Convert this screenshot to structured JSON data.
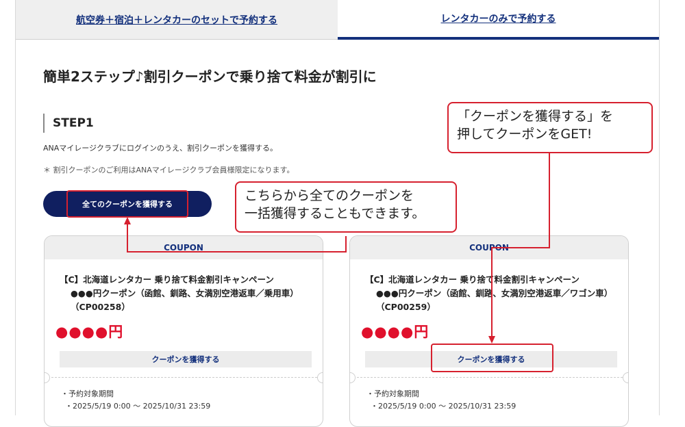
{
  "tabs": {
    "set_booking": "航空券＋宿泊＋レンタカーのセットで予約する",
    "rental_only": "レンタカーのみで予約する"
  },
  "main": {
    "heading": "簡単2ステップ♪割引クーポンで乗り捨て料金が割引に",
    "step_title": "STEP1",
    "step_desc": "ANAマイレージクラブにログインのうえ、割引クーポンを獲得する。",
    "step_note": "＊ 割引クーポンのご利用はANAマイレージクラブ会員様限定になります。",
    "get_all_button": "全てのクーポンを獲得する"
  },
  "coupons": [
    {
      "header": "COUPON",
      "title_line1": "【C】北海道レンタカー 乗り捨て料金割引キャンペーン",
      "title_line2": "●●●円クーポン（函館、釧路、女満別空港返車／乗用車）（CP00258）",
      "price": "●●●●円",
      "button": "クーポンを獲得する",
      "period_label": "・予約対象期間",
      "period": "・2025/5/19 0:00 ～ 2025/10/31 23:59"
    },
    {
      "header": "COUPON",
      "title_line1": "【C】北海道レンタカー 乗り捨て料金割引キャンペーン",
      "title_line2": "●●●円クーポン（函館、釧路、女満別空港返車／ワゴン車）（CP00259）",
      "price": "●●●●円",
      "button": "クーポンを獲得する",
      "period_label": "・予約対象期間",
      "period": "・2025/5/19 0:00 ～ 2025/10/31 23:59"
    }
  ],
  "annotations": {
    "callout_right_line1": "「クーポンを獲得する」を",
    "callout_right_line2": "押してクーポンをGET!",
    "callout_center_line1": "こちらから全てのクーポンを",
    "callout_center_line2": "一括獲得することもできます。",
    "highlight_color": "#d6202e"
  },
  "colors": {
    "brand_navy": "#101f60",
    "link_blue": "#13307c",
    "price_red": "#e0102c"
  }
}
